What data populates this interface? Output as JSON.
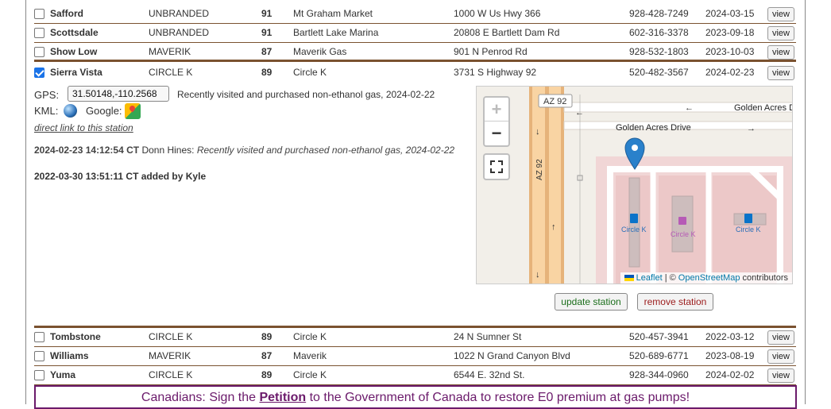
{
  "stations_top": [
    {
      "city": "Safford",
      "brand": "UNBRANDED",
      "octane": "91",
      "name": "Mt Graham Market",
      "address": "1000 W Us Hwy 366",
      "phone": "928-428-7249",
      "date": "2024-03-15",
      "view": "view",
      "checked": false
    },
    {
      "city": "Scottsdale",
      "brand": "UNBRANDED",
      "octane": "91",
      "name": "Bartlett Lake Marina",
      "address": "20808 E Bartlett Dam Rd",
      "phone": "602-316-3378",
      "date": "2023-09-18",
      "view": "view",
      "checked": false
    },
    {
      "city": "Show Low",
      "brand": "MAVERIK",
      "octane": "87",
      "name": "Maverik Gas",
      "address": "901 N Penrod Rd",
      "phone": "928-532-1803",
      "date": "2023-10-03",
      "view": "view",
      "checked": false
    },
    {
      "city": "Sierra Vista",
      "brand": "CIRCLE K",
      "octane": "89",
      "name": "Circle K",
      "address": "3731 S Highway 92",
      "phone": "520-482-3567",
      "date": "2024-02-23",
      "view": "view",
      "checked": true
    }
  ],
  "detail": {
    "gps_label": "GPS:",
    "gps_value": "31.50148,-110.2568",
    "gps_note": "Recently visited and purchased non-ethanol gas, 2024-02-22",
    "kml_label": "KML:",
    "google_label": "Google:",
    "direct_link": "direct link to this station",
    "log1_time": "2024-02-23 14:12:54 CT",
    "log1_by": "Donn Hines:",
    "log1_text": "Recently visited and purchased non-ethanol gas, 2024-02-22",
    "log2": "2022-03-30 13:51:11 CT added by Kyle",
    "update_label": "update station",
    "remove_label": "remove station"
  },
  "map": {
    "zoom_in": "+",
    "zoom_out": "−",
    "road_label_1": "AZ 92",
    "road_label_2": "Golden Acres D",
    "road_label_3": "Golden Acres Drive",
    "road_label_4": "AZ 92",
    "poi_1": "Circle K",
    "poi_2": "Circle K",
    "poi_3": "Circle K",
    "attr_leaflet": "Leaflet",
    "attr_sep": "| ©",
    "attr_osm": "OpenStreetMap",
    "attr_contrib": "contributors"
  },
  "stations_bottom": [
    {
      "city": "Tombstone",
      "brand": "CIRCLE K",
      "octane": "89",
      "name": "Circle K",
      "address": "24 N Sumner St",
      "phone": "520-457-3941",
      "date": "2022-03-12",
      "view": "view",
      "checked": false
    },
    {
      "city": "Williams",
      "brand": "MAVERIK",
      "octane": "87",
      "name": "Maverik",
      "address": "1022 N Grand Canyon Blvd",
      "phone": "520-689-6771",
      "date": "2023-08-19",
      "view": "view",
      "checked": false
    },
    {
      "city": "Yuma",
      "brand": "CIRCLE K",
      "octane": "89",
      "name": "Circle K",
      "address": "6544 E. 32nd St.",
      "phone": "928-344-0960",
      "date": "2024-02-02",
      "view": "view",
      "checked": false
    }
  ],
  "banner": {
    "pre": "Canadians: Sign the ",
    "link": "Petition",
    "post": " to the Government of Canada to restore E0 premium at gas pumps!"
  }
}
